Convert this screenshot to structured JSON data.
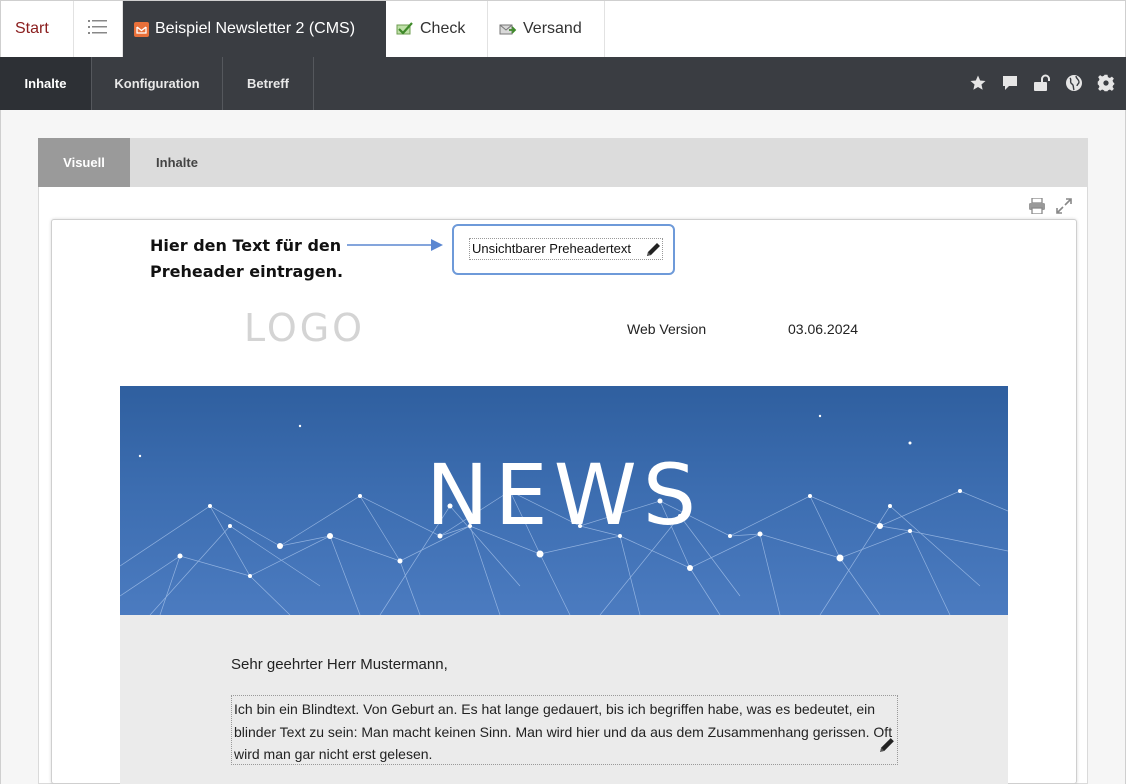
{
  "top_tabs": {
    "start": "Start",
    "newsletter": "Beispiel Newsletter 2 (CMS)",
    "check": "Check",
    "versand": "Versand"
  },
  "nav": {
    "items": [
      "Inhalte",
      "Konfiguration",
      "Betreff"
    ],
    "icons": [
      "star-icon",
      "comment-icon",
      "unlock-icon",
      "globe-icon",
      "gear-icon"
    ]
  },
  "subtabs": [
    "Visuell",
    "Inhalte"
  ],
  "tools": [
    "print-icon",
    "expand-icon"
  ],
  "hint": "Hier den Text für den\nPreheader eintragen.",
  "preheader": "Unsichtbarer Preheadertext",
  "email": {
    "logo": "LOGO",
    "web_version": "Web Version",
    "date": "03.06.2024",
    "banner_title": "NEWS",
    "greeting": "Sehr geehrter Herr Mustermann,",
    "body_text": "Ich bin ein Blindtext. Von Geburt an. Es hat lange gedauert, bis ich begriffen habe, was es bedeutet, ein blinder Text zu sein: Man macht keinen Sinn. Man wird hier und da aus dem Zusammenhang gerissen. Oft wird man gar nicht erst gelesen."
  },
  "colors": {
    "dark_nav": "#3a3d42",
    "start_red": "#8a1d1d",
    "highlight_blue": "#6e9ad9",
    "banner_blue": "#3c6db0"
  }
}
